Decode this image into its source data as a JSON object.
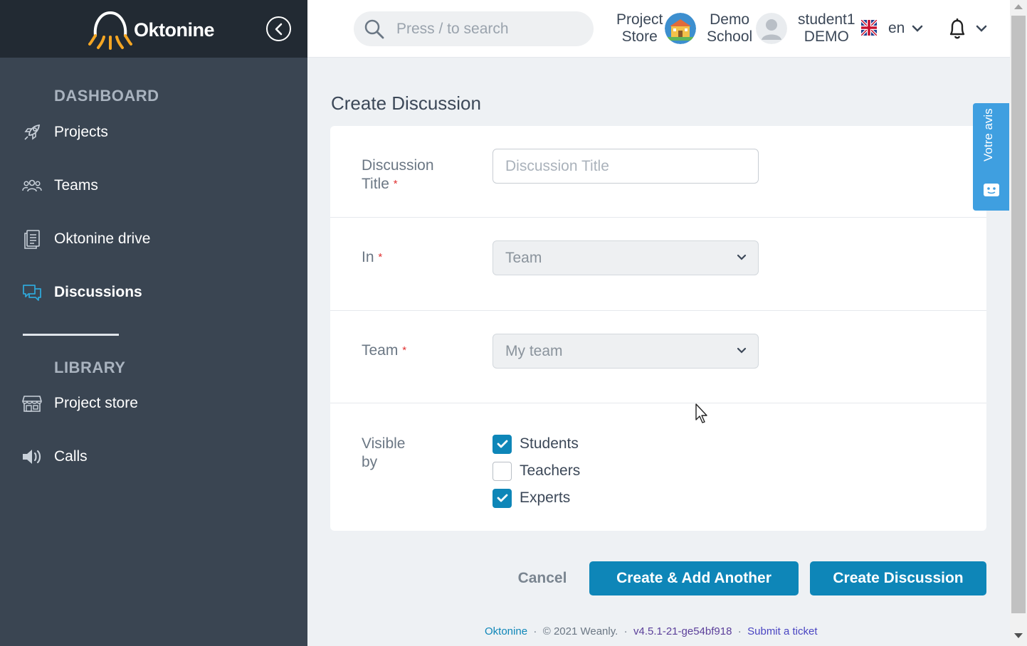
{
  "brand": {
    "name": "Oktonine"
  },
  "sidebar": {
    "sections": [
      {
        "title": "DASHBOARD"
      },
      {
        "title": "LIBRARY"
      }
    ],
    "items": [
      {
        "label": "Projects",
        "icon": "rocket-icon"
      },
      {
        "label": "Teams",
        "icon": "team-icon"
      },
      {
        "label": "Oktonine drive",
        "icon": "drive-icon"
      },
      {
        "label": "Discussions",
        "icon": "discussions-icon",
        "active": true
      },
      {
        "label": "Project store",
        "icon": "store-icon"
      },
      {
        "label": "Calls",
        "icon": "speaker-icon"
      }
    ]
  },
  "header": {
    "search_placeholder": "Press / to search",
    "project_store": {
      "line1": "Project",
      "line2": "Store"
    },
    "school": {
      "line1": "Demo",
      "line2": "School"
    },
    "user": {
      "line1": "student1",
      "line2": "DEMO"
    },
    "language": "en"
  },
  "form": {
    "page_title": "Create Discussion",
    "title_field": {
      "label_line1": "Discussion",
      "label_line2": "Title",
      "required": "*",
      "placeholder": "Discussion Title",
      "value": ""
    },
    "in_field": {
      "label": "In",
      "required": "*",
      "value": "Team"
    },
    "team_field": {
      "label": "Team",
      "required": "*",
      "value": "My team"
    },
    "visible_by": {
      "label_line1": "Visible",
      "label_line2": "by",
      "options": [
        {
          "label": "Students",
          "checked": true
        },
        {
          "label": "Teachers",
          "checked": false
        },
        {
          "label": "Experts",
          "checked": true
        }
      ]
    },
    "buttons": {
      "cancel": "Cancel",
      "create_add_another": "Create & Add Another",
      "create": "Create Discussion"
    }
  },
  "feedback_tab": {
    "label": "Votre avis"
  },
  "footer": {
    "brand": "Oktonine",
    "sep": "·",
    "copyright": "© 2021 Weanly.",
    "version": "v4.5.1-21-ge54bf918",
    "ticket": "Submit a ticket"
  },
  "colors": {
    "primary": "#0e86b8",
    "sidebar": "#3a4552",
    "brand_bar": "#222a33",
    "logo_orange": "#f5a623"
  }
}
